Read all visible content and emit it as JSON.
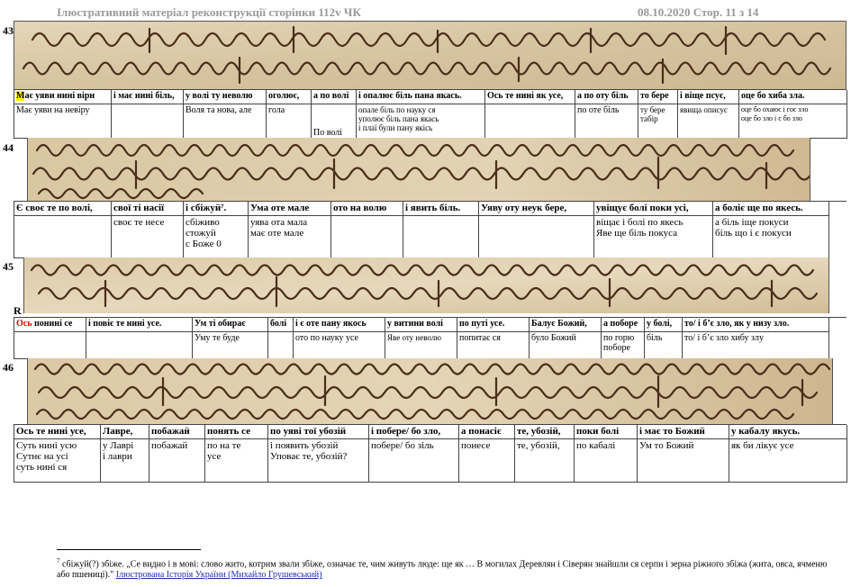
{
  "header": {
    "title": "Ілюстративний матеріал  реконструкції сторінки 112v ЧК",
    "date_page": "08.10.2020  Стор. 11 з 14"
  },
  "blocks": [
    {
      "number": "43",
      "headers": [
        "Має уяви нині вірн",
        "і має нині біль,",
        "у волі ту неволю",
        "оголює,",
        "а по волі",
        "і опалює біль пана якась.",
        "Ось те нині як усе,",
        "а по оту біль",
        "то бере",
        "і віще псує,",
        "оце бо хиба зла."
      ],
      "cells": [
        "Має уяви на невіру",
        "",
        "Воля та нова, але",
        "гола",
        "По волі",
        "опале біль по науку ся\nуполює біль пана якась\nі плаї були пану якісь",
        "",
        "по оте біль",
        "ту бере\nтабір",
        "явища описує",
        "оце бо охаює і гоє зло\nоце бо зло і є бо зло"
      ]
    },
    {
      "number": "44",
      "headers": [
        "Є своє те по волі,",
        "свої ті насії",
        "і сбіжуй⁷.",
        "Ума оте мале",
        "ото на волю",
        "і явить біль.",
        "Уяву оту неук бере,",
        "увіщує болі поки усі,",
        "а боліє ще по якесь."
      ],
      "cells": [
        "",
        "своє те несе",
        "сбіживо\nстожуй\nс Боже 0",
        "уява ота мала\nмає оте мале",
        "",
        "",
        "",
        "віщає і болі по якесь\nЯве ще біль покуса",
        "а біль іще покуси\nбіль що і є покуси"
      ]
    },
    {
      "number": "45",
      "marker": "R",
      "headers": [
        "Ось понині се",
        "і повіє те нині усе.",
        "Ум ті обирає",
        "болі",
        "і є оте пану якось",
        "у витини волі",
        "по путі усе.",
        "Балує Божий,",
        "а поборе",
        "у болі,",
        "то/ і б’є зло, як у низу зло."
      ],
      "cells": [
        "",
        "",
        "Уму те буде",
        "",
        "ото по науку усе",
        "Яве оту неволю",
        "попитає ся",
        "було Божий",
        "по горю\nпоборе",
        "біль",
        "то/ і б’є зло хибу злу"
      ]
    },
    {
      "number": "46",
      "headers": [
        "Ось те нині усе,",
        "Лавре,",
        "побажай",
        "понять се",
        "по уяві тої убозій",
        "і побере/ бо зло,",
        "а понасіє",
        "те, убозій,",
        "поки болі",
        "і має то Божий",
        "у кабалу якусь."
      ],
      "cells": [
        "Суть нині усю\nСутнє на усі\nсуть нині ся",
        "у Лаврі\nі лаври",
        "побажай",
        "по на те\nусе",
        "і появить убозій\nУповає те, убозій?",
        "побере/ бо зіль",
        "понесе",
        "те, убозій,",
        "по кабалі",
        "Ум то Божий",
        "як би лікує усе"
      ]
    }
  ],
  "footnote": {
    "number": "7",
    "text": "сбіжуй(?) збіже. „Се видно і в мові: слово жито, котрим звали збіже, означає те, чим живуть люде: ще як … В могилах Деревлян і Сіверян знайшли ся серпи і зерна ріжного збіжа (жита, овса, ячменю або пшениці).\" ",
    "link_text": "Ілюстрована Історія України (Михайло Грушевський)"
  },
  "colors": {
    "highlight": "#fff200",
    "red_text": "#e00000",
    "header_gray": "#9a9a9a",
    "parchment": "#d9c9a8",
    "ink": "#4a2e1a"
  }
}
